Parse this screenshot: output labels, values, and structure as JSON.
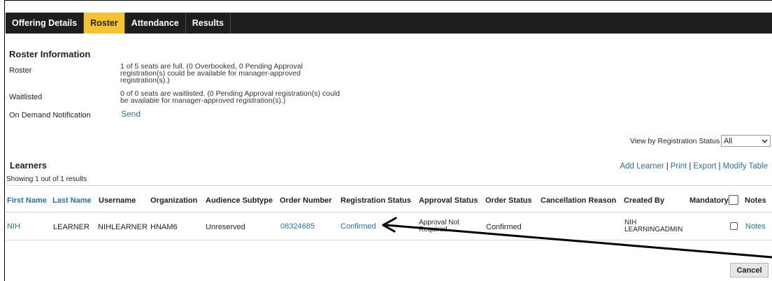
{
  "tabs": [
    {
      "label": "Offering Details",
      "active": false
    },
    {
      "label": "Roster",
      "active": true
    },
    {
      "label": "Attendance",
      "active": false
    },
    {
      "label": "Results",
      "active": false
    }
  ],
  "roster_info": {
    "title": "Roster Information",
    "roster_label": "Roster",
    "roster_value": "1 of 5 seats are full. (0 Overbooked, 0 Pending Approval registration(s) could be available for manager-approved registration(s).)",
    "waitlisted_label": "Waitlisted",
    "waitlisted_value": "0 of 0 seats are waitlisted. (0 Pending Approval registration(s) could be available for manager-approved registration(s).)",
    "notification_label": "On Demand Notification",
    "notification_link": "Send"
  },
  "filter": {
    "label": "View by Registration Status",
    "selected": "All"
  },
  "learners": {
    "title": "Learners",
    "showing": "Showing 1 out of 1 results",
    "actions": [
      "Add Learner",
      "Print",
      "Export",
      "Modify Table"
    ]
  },
  "table": {
    "headers": {
      "first_name": "First Name",
      "last_name": "Last Name",
      "username": "Username",
      "organization": "Organization",
      "audience_subtype": "Audience Subtype",
      "order_number": "Order Number",
      "registration_status": "Registration Status",
      "approval_status": "Approval Status",
      "order_status": "Order Status",
      "cancellation_reason": "Cancellation Reason",
      "created_by": "Created By",
      "mandatory": "Mandatory",
      "notes": "Notes"
    },
    "rows": [
      {
        "first_name": "NIH",
        "last_name": "LEARNER",
        "username": "NIHLEARNER",
        "organization": "HNAM6",
        "audience_subtype": "Unreserved",
        "order_number": "08324685",
        "registration_status": "Confirmed",
        "approval_status": "Approval Not Required",
        "order_status": "Confirmed",
        "cancellation_reason": "",
        "created_by": "NIH LEARNINGADMIN",
        "notes": "Notes"
      }
    ]
  },
  "buttons": {
    "cancel": "Cancel"
  },
  "icons": {
    "select_arrow": "chevron-down-icon",
    "annotation": "arrow-annotation"
  }
}
